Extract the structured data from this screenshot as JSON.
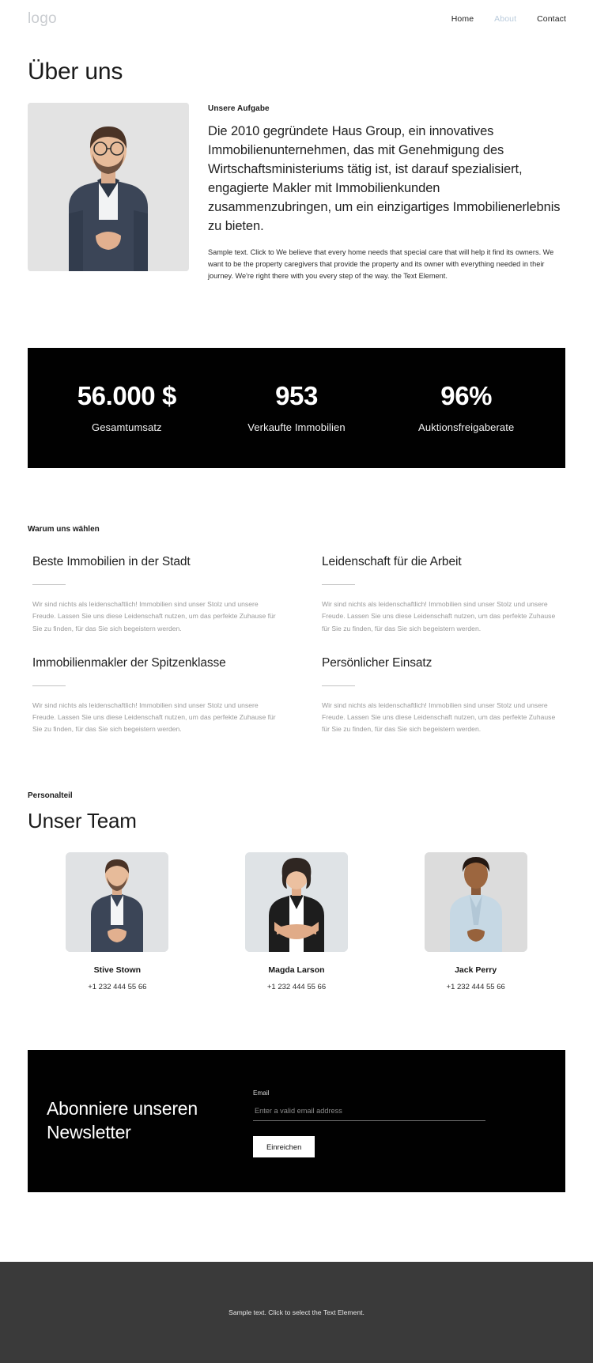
{
  "header": {
    "logo": "logo",
    "nav": [
      {
        "label": "Home",
        "active": false
      },
      {
        "label": "About",
        "active": true
      },
      {
        "label": "Contact",
        "active": false
      }
    ]
  },
  "page": {
    "title": "Über uns"
  },
  "about": {
    "eyebrow": "Unsere Aufgabe",
    "lead": "Die 2010 gegründete Haus Group, ein innovatives Immobilienunternehmen, das mit Genehmigung des Wirtschaftsministeriums tätig ist, ist darauf spezialisiert, engagierte Makler mit Immobilienkunden zusammenzubringen, um ein einzigartiges Immobilienerlebnis zu bieten.",
    "copy": "Sample text. Click to We believe that every home needs that special care that will help it find its owners. We want to be the property caregivers that provide the property and its owner with everything needed in their journey. We're right there with you every step of the way. the Text Element.",
    "photo_alt": "portrait-man-blue-shirt"
  },
  "stats": [
    {
      "value": "56.000 $",
      "label": "Gesamtumsatz"
    },
    {
      "value": "953",
      "label": "Verkaufte Immobilien"
    },
    {
      "value": "96%",
      "label": "Auktionsfreigaberate"
    }
  ],
  "why": {
    "eyebrow": "Warum uns wählen",
    "body": "Wir sind nichts als leidenschaftlich! Immobilien sind unser Stolz und unsere Freude. Lassen Sie uns diese Leidenschaft nutzen, um das perfekte Zuhause für Sie zu finden, für das Sie sich begeistern werden.",
    "items": [
      {
        "title": "Beste Immobilien in der Stadt"
      },
      {
        "title": "Leidenschaft für die Arbeit"
      },
      {
        "title": "Immobilienmakler der Spitzenklasse"
      },
      {
        "title": "Persönlicher Einsatz"
      }
    ]
  },
  "team": {
    "eyebrow": "Personalteil",
    "title": "Unser Team",
    "members": [
      {
        "name": "Stive Stown",
        "phone": "+1 232 444 55 66",
        "photo_alt": "portrait-man-navy-shirt"
      },
      {
        "name": "Magda Larson",
        "phone": "+1 232 444 55 66",
        "photo_alt": "portrait-woman-dark-vest"
      },
      {
        "name": "Jack Perry",
        "phone": "+1 232 444 55 66",
        "photo_alt": "portrait-man-light-shirt"
      }
    ]
  },
  "newsletter": {
    "heading": "Abonniere unseren Newsletter",
    "email_label": "Email",
    "email_value": "",
    "email_placeholder": "Enter a valid email address",
    "submit_label": "Einreichen"
  },
  "footer": {
    "text": "Sample text. Click to select the Text Element."
  },
  "colors": {
    "dark_band": "#010101",
    "footer": "#3a3a3a",
    "nav_active": "#b9cbdc",
    "muted": "#9a9a9a"
  }
}
